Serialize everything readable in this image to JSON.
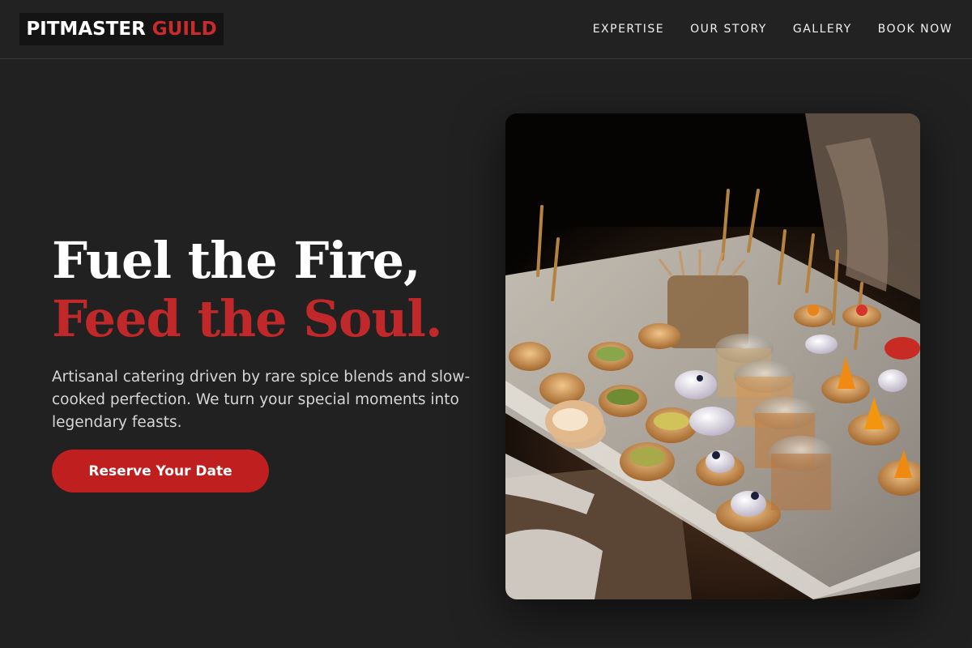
{
  "header": {
    "logo": {
      "part1": "PITMASTER",
      "part2": "GUILD"
    },
    "nav": [
      {
        "label": "EXPERTISE"
      },
      {
        "label": "OUR STORY"
      },
      {
        "label": "GALLERY"
      },
      {
        "label": "BOOK NOW"
      }
    ]
  },
  "hero": {
    "title_line1": "Fuel the Fire,",
    "title_line2": "Feed the Soul.",
    "description": "Artisanal catering driven by rare spice blends and slow-cooked perfection. We turn your special moments into legendary feasts.",
    "cta_label": "Reserve Your Date",
    "image": {
      "subject": "catering appetizer platter photo"
    }
  },
  "colors": {
    "background": "#212121",
    "accent": "#c01f1f",
    "text": "#ffffff",
    "muted_text": "#d6d6d6"
  }
}
